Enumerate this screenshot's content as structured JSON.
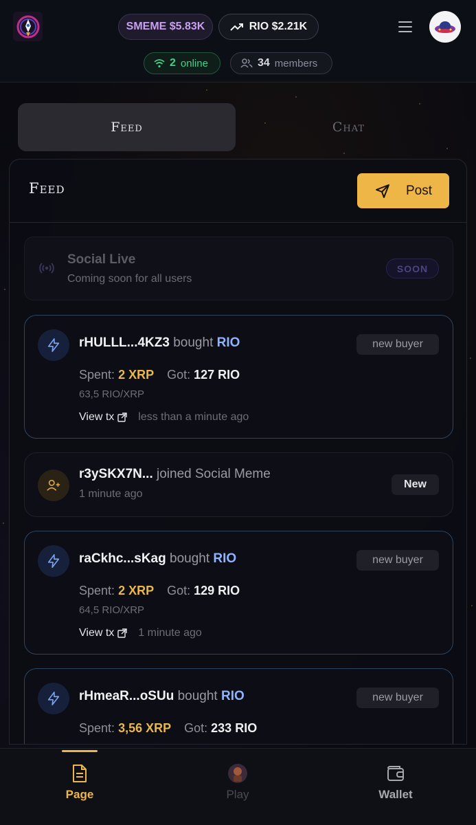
{
  "header": {
    "smeme_price": "SMEME $5.83K",
    "rio_price": "RIO $2.21K",
    "online_count": "2",
    "online_label": "online",
    "members_count": "34",
    "members_label": "members"
  },
  "tabs": [
    {
      "label": "Feed",
      "active": true
    },
    {
      "label": "Chat",
      "active": false
    }
  ],
  "feed": {
    "title": "Feed",
    "post_label": "Post",
    "social_live": {
      "title": "Social Live",
      "subtitle": "Coming soon for all users",
      "badge": "SOON"
    },
    "events": [
      {
        "type": "buy",
        "address": "rHULLL...4KZ3",
        "action": "bought",
        "token": "RIO",
        "badge": "new buyer",
        "spent_label": "Spent:",
        "spent_value": "2 XRP",
        "got_label": "Got:",
        "got_value": "127 RIO",
        "rate": "63,5 RIO/XRP",
        "view_tx": "View tx",
        "time": "less than a minute ago"
      },
      {
        "type": "join",
        "address": "r3ySKX7N...",
        "action": "joined Social Meme",
        "badge": "New",
        "time": "1 minute ago"
      },
      {
        "type": "buy",
        "address": "raCkhc...sKag",
        "action": "bought",
        "token": "RIO",
        "badge": "new buyer",
        "spent_label": "Spent:",
        "spent_value": "2 XRP",
        "got_label": "Got:",
        "got_value": "129 RIO",
        "rate": "64,5 RIO/XRP",
        "view_tx": "View tx",
        "time": "1 minute ago"
      },
      {
        "type": "buy",
        "address": "rHmeaR...oSUu",
        "action": "bought",
        "token": "RIO",
        "badge": "new buyer",
        "spent_label": "Spent:",
        "spent_value": "3,56 XRP",
        "got_label": "Got:",
        "got_value": "233 RIO"
      }
    ]
  },
  "bottom_nav": [
    {
      "label": "Page",
      "icon": "document-icon",
      "active": true
    },
    {
      "label": "Play",
      "icon": "play-avatar-icon",
      "active": false
    },
    {
      "label": "Wallet",
      "icon": "wallet-icon",
      "active": false
    }
  ],
  "colors": {
    "accent": "#eeb547",
    "token_blue": "#8fb4ff",
    "online_green": "#3fd38a",
    "background": "#0a0a10"
  }
}
